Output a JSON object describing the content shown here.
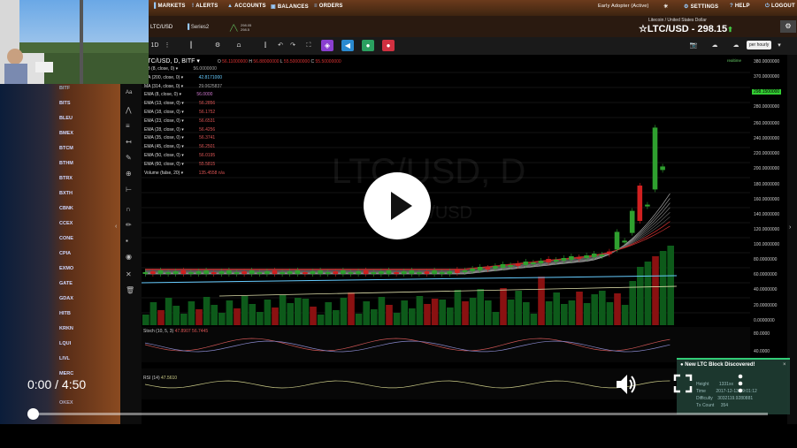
{
  "nav": {
    "items": [
      {
        "icon": "bar-chart-icon",
        "label": "MARKETS"
      },
      {
        "icon": "alert-icon",
        "label": "ALERTS"
      },
      {
        "icon": "accounts-icon",
        "label": "ACCOUNTS"
      },
      {
        "icon": "balances-icon",
        "label": "BALANCES"
      },
      {
        "icon": "orders-icon",
        "label": "ORDERS"
      }
    ],
    "user_status": "Early Adopter (Active)",
    "right": [
      {
        "icon": "gear-icon",
        "label": "SETTINGS"
      },
      {
        "icon": "help-icon",
        "label": "HELP"
      },
      {
        "icon": "logout-icon",
        "label": "LOGOUT"
      }
    ]
  },
  "ticker": {
    "symbol_tab": "LTC/USD",
    "series_tab": "Series2",
    "mini_price_top": "298.05",
    "mini_price_bottom": "298.5",
    "subtitle": "Litecoin / United States Dollar",
    "title": "LTC/USD - 298.15",
    "direction": "up"
  },
  "toolbar": {
    "interval": "1D",
    "timezone_btn": "per hourly"
  },
  "chart": {
    "symbol_line": "LTC/USD, D, BITF",
    "ohlc": {
      "O": "56.11000000",
      "H": "56.88000000",
      "L": "55.50000000",
      "C": "55.50000000"
    },
    "watermark_main": "LTC/USD, D",
    "watermark_sub": "LTC/USD",
    "status_label": "realtime",
    "indicators": [
      {
        "label": "BB (8, close, 0)",
        "value": "56.0000000"
      },
      {
        "label": "MA (200, close, 0)",
        "value": "42.8171000"
      },
      {
        "label": "MA (314, close, 0)",
        "value": "29.0625837"
      },
      {
        "label": "EMA (8, close, 0)",
        "value": "56.0000"
      },
      {
        "label": "EMA (13, close, 0)",
        "value": "56.2856"
      },
      {
        "label": "EMA (18, close, 0)",
        "value": "56.1752"
      },
      {
        "label": "EMA (23, close, 0)",
        "value": "56.6531"
      },
      {
        "label": "EMA (28, close, 0)",
        "value": "56.4256"
      },
      {
        "label": "EMA (35, close, 0)",
        "value": "56.3741"
      },
      {
        "label": "EMA (45, close, 0)",
        "value": "56.2501"
      },
      {
        "label": "EMA (50, close, 0)",
        "value": "56.0195"
      },
      {
        "label": "EMA (60, close, 0)",
        "value": "55.5815"
      },
      {
        "label": "Volume (false, 20)",
        "value": "135.4558 n/a"
      }
    ],
    "price_axis": [
      "380.0000000",
      "370.0000000",
      "360.0000000",
      "298.1500000",
      "280.0000000",
      "260.0000000",
      "240.0000000",
      "220.0000000",
      "200.0000000",
      "180.0000000",
      "160.0000000",
      "140.0000000",
      "120.0000000",
      "100.0000000",
      "80.0000000",
      "60.0000000",
      "40.0000000",
      "20.0000000",
      "0.0000000"
    ],
    "current_price_tag": "298.1500000",
    "stoch_label": "Stoch (10, 5, 3)",
    "stoch_values": "47.8907 56.7445",
    "stoch_axis": [
      "80.0000",
      "40.0000"
    ],
    "rsi_label": "RSI (14)",
    "rsi_values": "47.5610"
  },
  "sidebar": {
    "exchanges": [
      "BITF",
      "BITS",
      "BLEU",
      "BMEX",
      "BTCM",
      "BTHM",
      "BTRX",
      "BXTH",
      "CBNK",
      "CCEX",
      "CONE",
      "CPIA",
      "EXMO",
      "GATE",
      "GDAX",
      "HITB",
      "KRKN",
      "LQUI",
      "LIVL",
      "MERC",
      "OKEX"
    ]
  },
  "popup": {
    "title": "New LTC Block Discovered!",
    "rows": [
      {
        "k": "Height",
        "v": "1331xx"
      },
      {
        "k": "Time",
        "v": "2017-12-13 09:01:12"
      },
      {
        "k": "Difficulty",
        "v": "3032119.9280881"
      },
      {
        "k": "Tx Count",
        "v": "354"
      }
    ]
  },
  "video": {
    "time": "0:00 / 4:50",
    "progress": 0
  },
  "colors": {
    "up": "#2fa02f",
    "down": "#d02020",
    "nav_bg": "#4a2a14",
    "accent": "#3bc07a"
  }
}
